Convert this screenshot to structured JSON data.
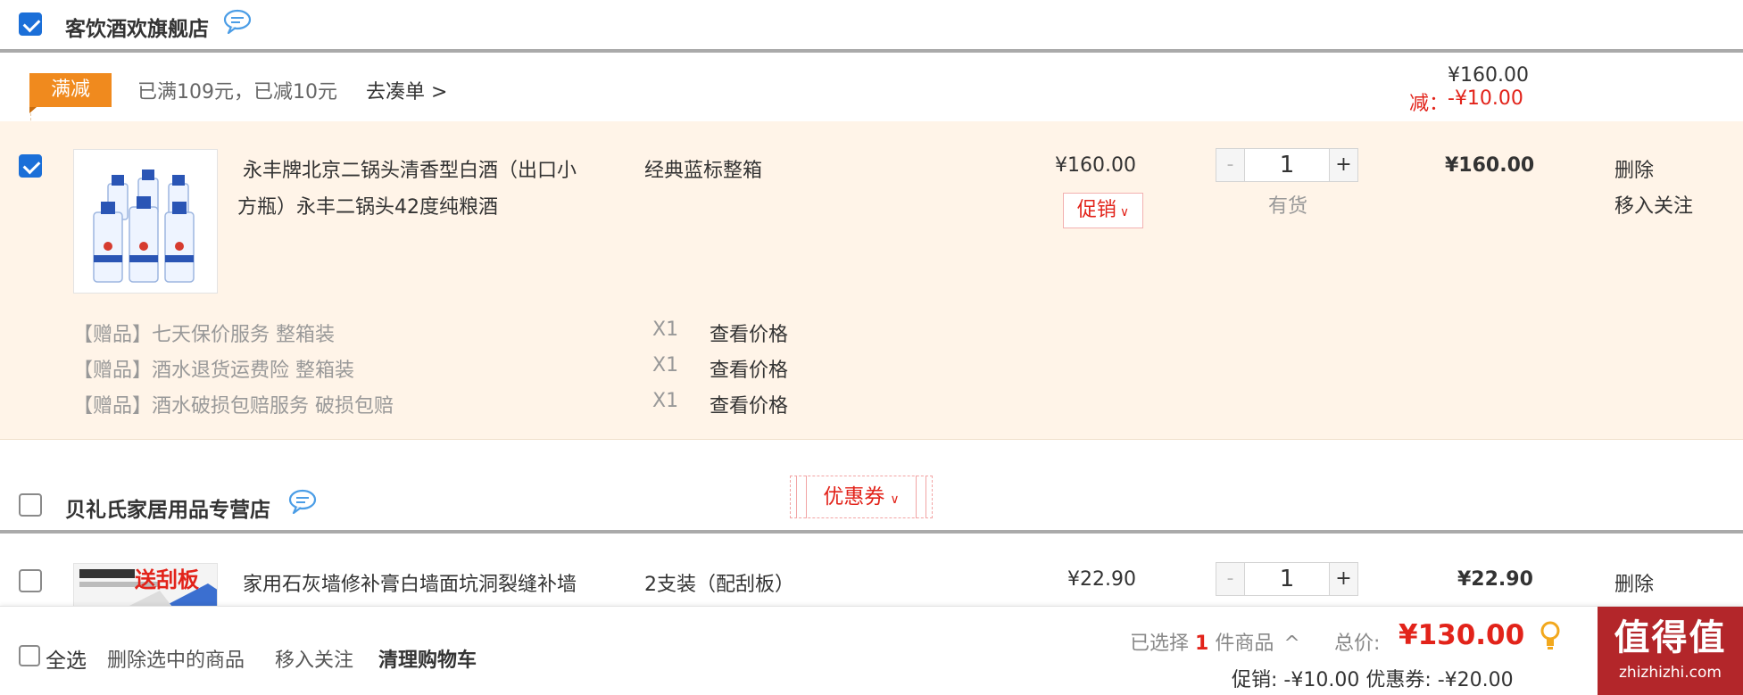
{
  "shop1": {
    "name": "客饮酒欢旗舰店",
    "checked": true,
    "promo": {
      "tag": "满减",
      "text": "已满109元，已减10元",
      "link": "去凑单 >",
      "subtotal": "¥160.00",
      "discount_label": "减：",
      "discount": "-¥10.00"
    },
    "item": {
      "title_line1": "永丰牌北京二锅头清香型白酒（出口小",
      "title_line2": "方瓶）永丰二锅头42度纯粮酒",
      "spec": "经典蓝标整箱",
      "price": "¥160.00",
      "promo_button": "促销",
      "quantity": "1",
      "minus": "-",
      "plus": "+",
      "stock": "有货",
      "total": "¥160.00",
      "delete": "删除",
      "follow": "移入关注"
    },
    "gifts": [
      {
        "name": "【赠品】七天保价服务 整箱装",
        "qty": "X1",
        "link": "查看价格"
      },
      {
        "name": "【赠品】酒水退货运费险 整箱装",
        "qty": "X1",
        "link": "查看价格"
      },
      {
        "name": "【赠品】酒水破损包赔服务 破损包赔",
        "qty": "X1",
        "link": "查看价格"
      }
    ]
  },
  "shop2": {
    "name": "贝礼氏家居用品专营店",
    "checked": false,
    "coupon": "优惠券",
    "item": {
      "title_line1": "家用石灰墙修补膏白墙面坑洞裂缝补墙",
      "thumb_text": "送刮板",
      "spec": "2支装（配刮板）",
      "price": "¥22.90",
      "quantity": "1",
      "minus": "-",
      "plus": "+",
      "total": "¥22.90",
      "delete": "删除"
    }
  },
  "footer": {
    "select_all": "全选",
    "delete_selected": "删除选中的商品",
    "move_follow": "移入关注",
    "clear_cart": "清理购物车",
    "selected_prefix": "已选择",
    "selected_count": "1",
    "selected_suffix": "件商品",
    "total_label": "总价:",
    "total": "¥130.00",
    "promo_line": "促销: -¥10.00 优惠券: -¥20.00"
  },
  "watermark": {
    "big": "值得值",
    "small": "zhizhizhi.com"
  },
  "colors": {
    "accent_red": "#e2231a",
    "promo_bg": "#fff4e8",
    "tag_orange": "#f08a1e",
    "checkbox_blue": "#1b6fd8"
  }
}
